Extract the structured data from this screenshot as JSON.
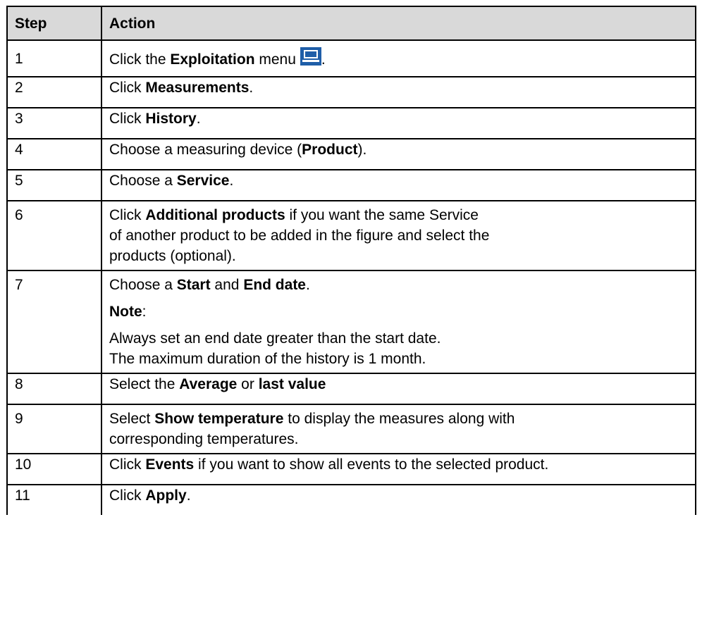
{
  "table": {
    "headers": {
      "step": "Step",
      "action": "Action"
    },
    "rows": [
      {
        "step": "1",
        "pre": "Click the ",
        "b1": "Exploitation",
        "post": " menu",
        "tail": "."
      },
      {
        "step": "2",
        "pre": "Click ",
        "b1": "Measurements",
        "post": "."
      },
      {
        "step": "3",
        "pre": "Click ",
        "b1": "History",
        "post": "."
      },
      {
        "step": "4",
        "pre": "Choose a measuring device (",
        "b1": "Product",
        "post": ")."
      },
      {
        "step": "5",
        "pre": "Choose a ",
        "b1": "Service",
        "post": "."
      },
      {
        "step": "6",
        "pre": "Click ",
        "b1": "Additional products",
        "post": " if you want the same Service",
        "line2": "of another product to be added in the figure and select the",
        "line3": "products (optional)."
      },
      {
        "step": "7",
        "pre": "Choose a ",
        "b1": "Start",
        "mid": " and ",
        "b2": "End date",
        "post": ".",
        "note_label": "Note",
        "note_colon": ":",
        "note1": "Always set an end date greater than the start date.",
        "note2": "The maximum duration of the history is 1 month."
      },
      {
        "step": "8",
        "pre": "Select the ",
        "b1": "Average",
        "mid": " or ",
        "b2": "last value"
      },
      {
        "step": "9",
        "pre": "Select ",
        "b1": "Show temperature",
        "post": " to display the measures along with",
        "line2": "corresponding temperatures."
      },
      {
        "step": "10",
        "pre": "Click ",
        "b1": "Events",
        "post": " if you want to show all events to the selected product."
      },
      {
        "step": "11",
        "pre": "Click ",
        "b1": "Apply",
        "post": "."
      }
    ]
  },
  "icons": {
    "exploitation": "monitor-icon",
    "accent": "#1f5ea8"
  }
}
